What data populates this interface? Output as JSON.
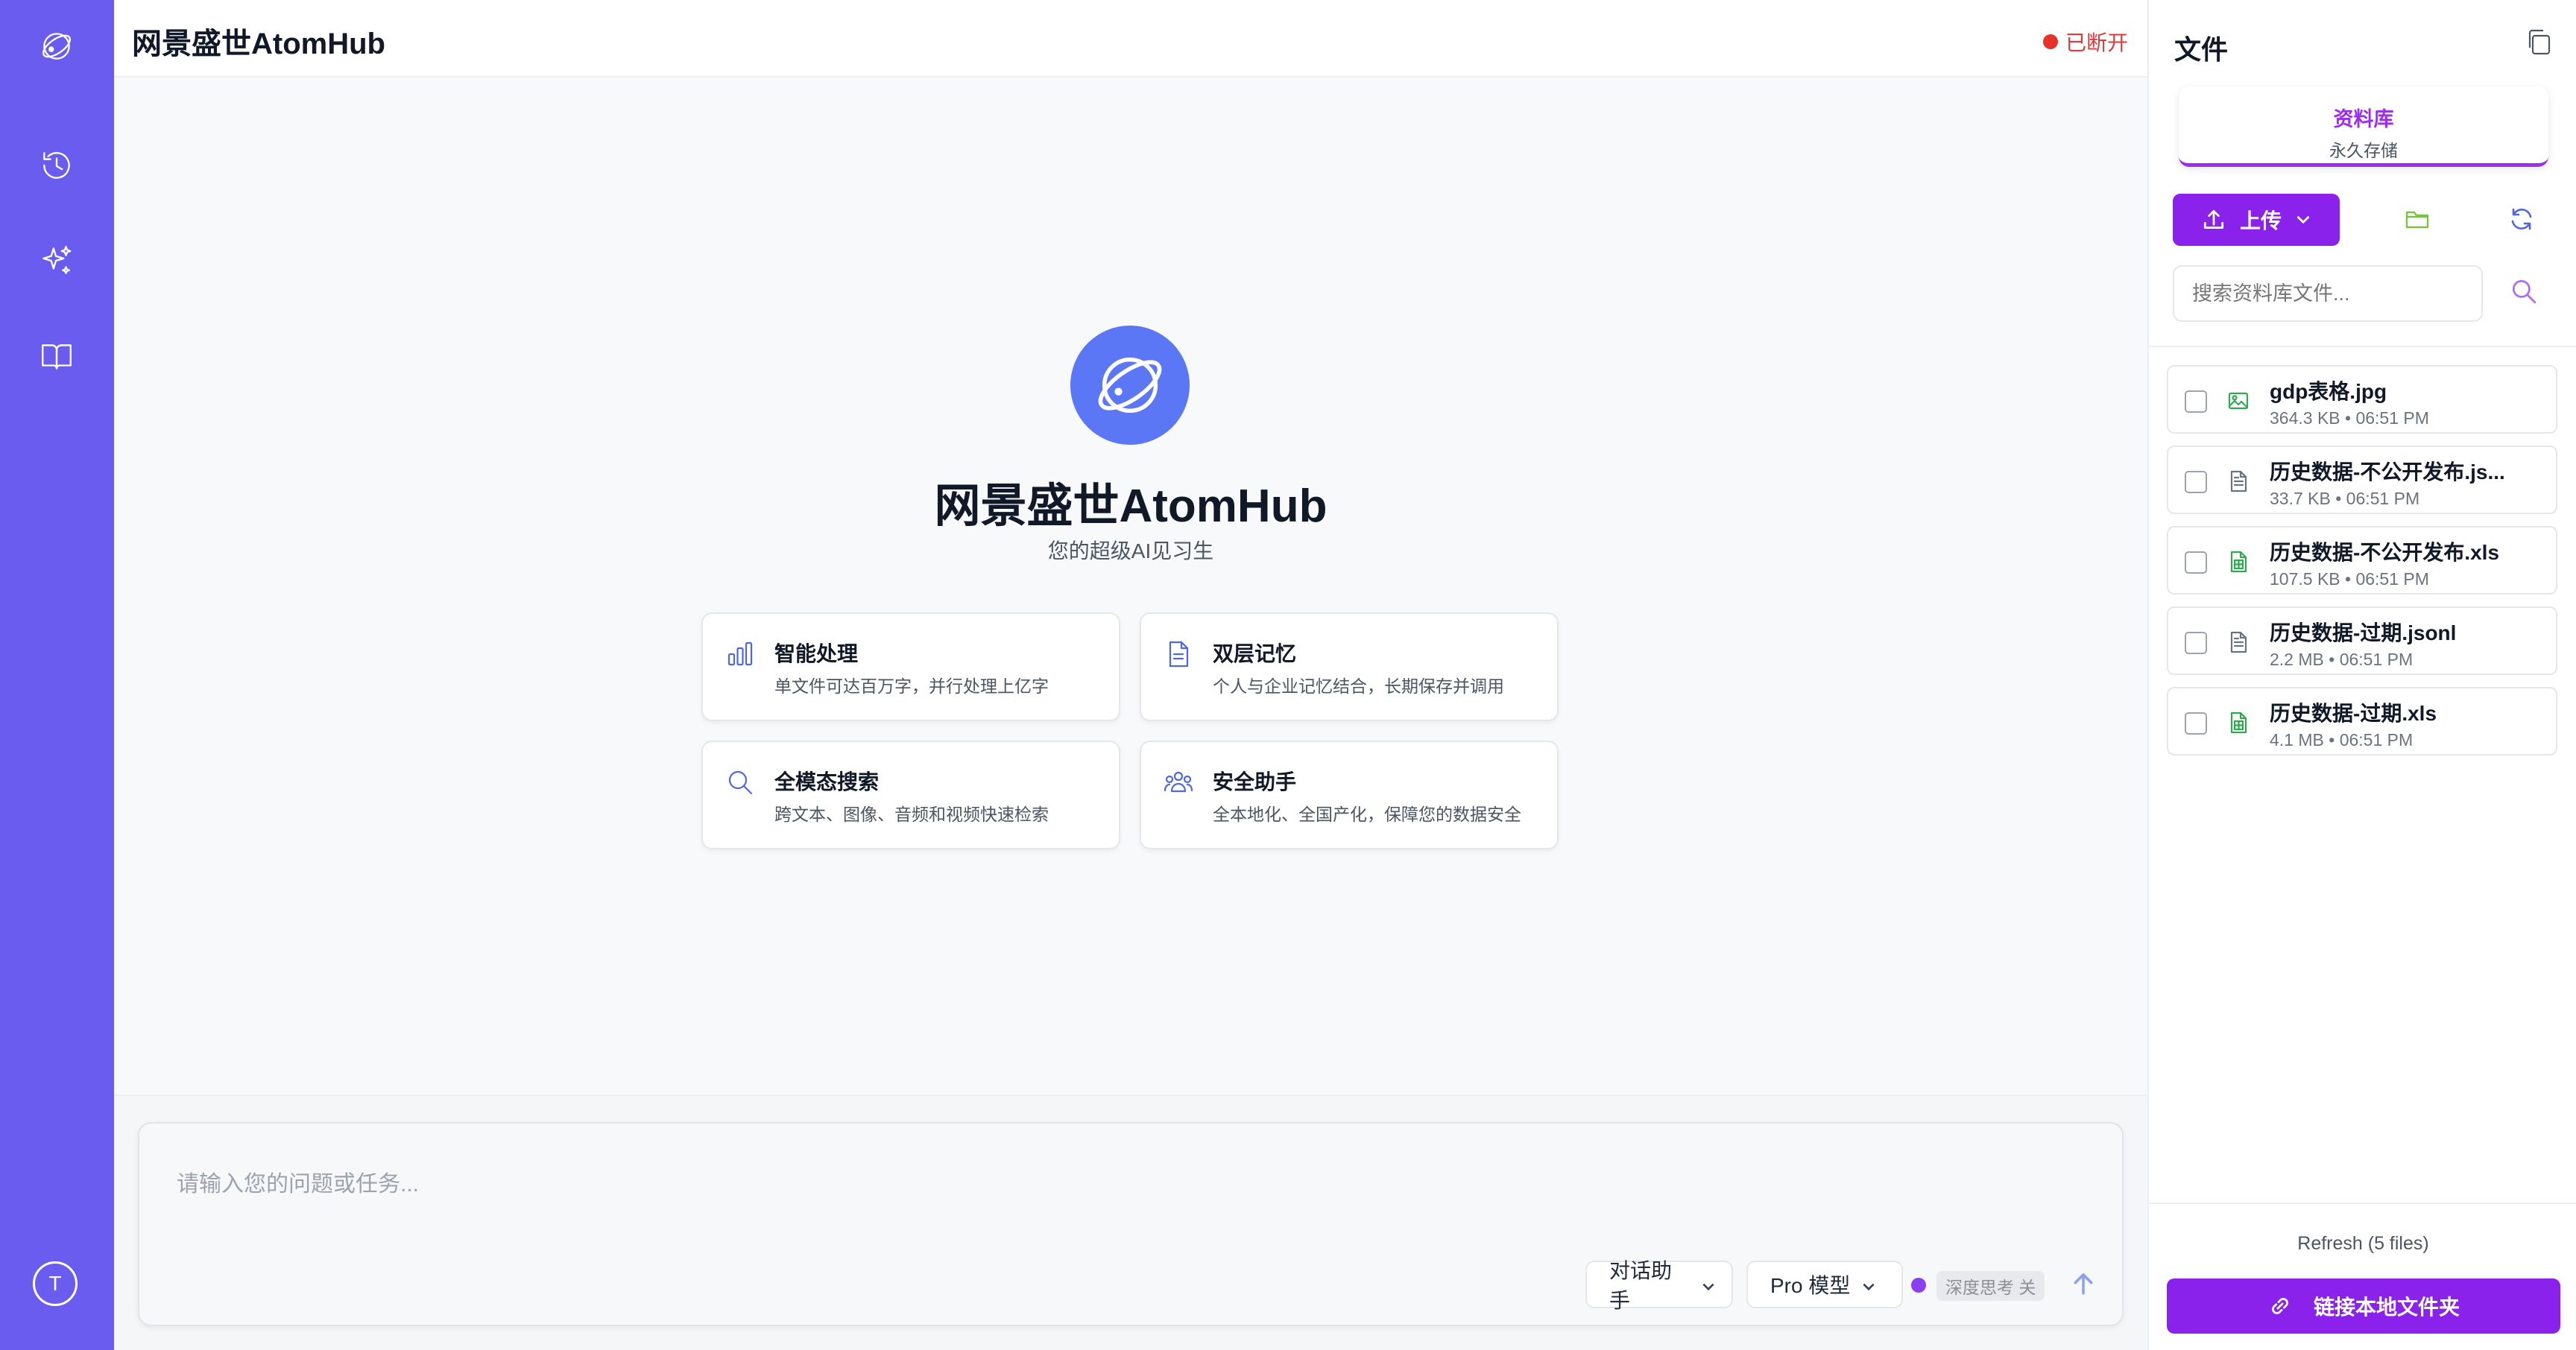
{
  "app": {
    "title": "网景盛世AtomHub",
    "status": "已断开"
  },
  "sidebar": {
    "icons": [
      "logo-icon",
      "history-icon",
      "sparkles-icon",
      "book-icon"
    ],
    "avatar_initial": "T"
  },
  "hero": {
    "title": "网景盛世AtomHub",
    "subtitle": "您的超级AI见习生"
  },
  "features": [
    {
      "title": "智能处理",
      "desc": "单文件可达百万字，并行处理上亿字",
      "icon": "bar-chart-icon"
    },
    {
      "title": "双层记忆",
      "desc": "个人与企业记忆结合，长期保存并调用",
      "icon": "document-icon"
    },
    {
      "title": "全模态搜索",
      "desc": "跨文本、图像、音频和视频快速检索",
      "icon": "search-icon"
    },
    {
      "title": "安全助手",
      "desc": "全本地化、全国产化，保障您的数据安全",
      "icon": "users-icon"
    }
  ],
  "composer": {
    "placeholder": "请输入您的问题或任务...",
    "assistant_select": "对话助手",
    "model_select": "Pro 模型",
    "deep_think": "深度思考 关"
  },
  "files_panel": {
    "title": "文件",
    "library_tab": {
      "label": "资料库",
      "sublabel": "永久存储"
    },
    "upload_label": "上传",
    "search_placeholder": "搜索资料库文件...",
    "files": [
      {
        "name": "gdp表格.jpg",
        "meta": "364.3 KB • 06:51 PM",
        "type": "image"
      },
      {
        "name": "历史数据-不公开发布.js...",
        "meta": "33.7 KB • 06:51 PM",
        "type": "text"
      },
      {
        "name": "历史数据-不公开发布.xls",
        "meta": "107.5 KB • 06:51 PM",
        "type": "sheet"
      },
      {
        "name": "历史数据-过期.jsonl",
        "meta": "2.2 MB • 06:51 PM",
        "type": "text"
      },
      {
        "name": "历史数据-过期.xls",
        "meta": "4.1 MB • 06:51 PM",
        "type": "sheet"
      }
    ],
    "refresh_text": "Refresh (5 files)",
    "link_folder_label": "链接本地文件夹"
  },
  "colors": {
    "rail": "#6b5cf0",
    "accent": "#8a22ec",
    "brand_blue": "#5b77f5",
    "status_red": "#e5332a"
  }
}
